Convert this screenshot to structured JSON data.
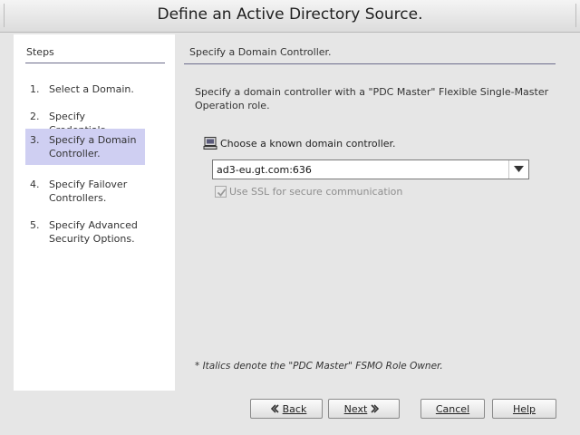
{
  "window": {
    "title": "Define an Active Directory Source."
  },
  "steps": {
    "title": "Steps",
    "items": [
      {
        "num": "1.",
        "label": "Select a Domain.",
        "active": false
      },
      {
        "num": "2.",
        "label": "Specify Credentials.",
        "active": false
      },
      {
        "num": "3.",
        "label": "Specify a Domain Controller.",
        "active": true
      },
      {
        "num": "4.",
        "label": "Specify Failover Controllers.",
        "active": false
      },
      {
        "num": "5.",
        "label": "Specify Advanced Security Options.",
        "active": false
      }
    ]
  },
  "main": {
    "header": "Specify a Domain Controller.",
    "description": "Specify a domain controller with a \"PDC Master\" Flexible Single-Master Operation role.",
    "choose_label": "Choose a known domain controller.",
    "controller_value": "ad3-eu.gt.com:636",
    "ssl_label": "Use SSL for secure communication",
    "ssl_checked": true,
    "ssl_enabled": false,
    "note": "* Italics denote the \"PDC Master\" FSMO Role Owner."
  },
  "buttons": {
    "back": "Back",
    "next": "Next",
    "cancel": "Cancel",
    "help": "Help"
  },
  "colors": {
    "active_step": "#cfcff2",
    "rule": "#6c6c8c",
    "background": "#e6e6e6"
  }
}
